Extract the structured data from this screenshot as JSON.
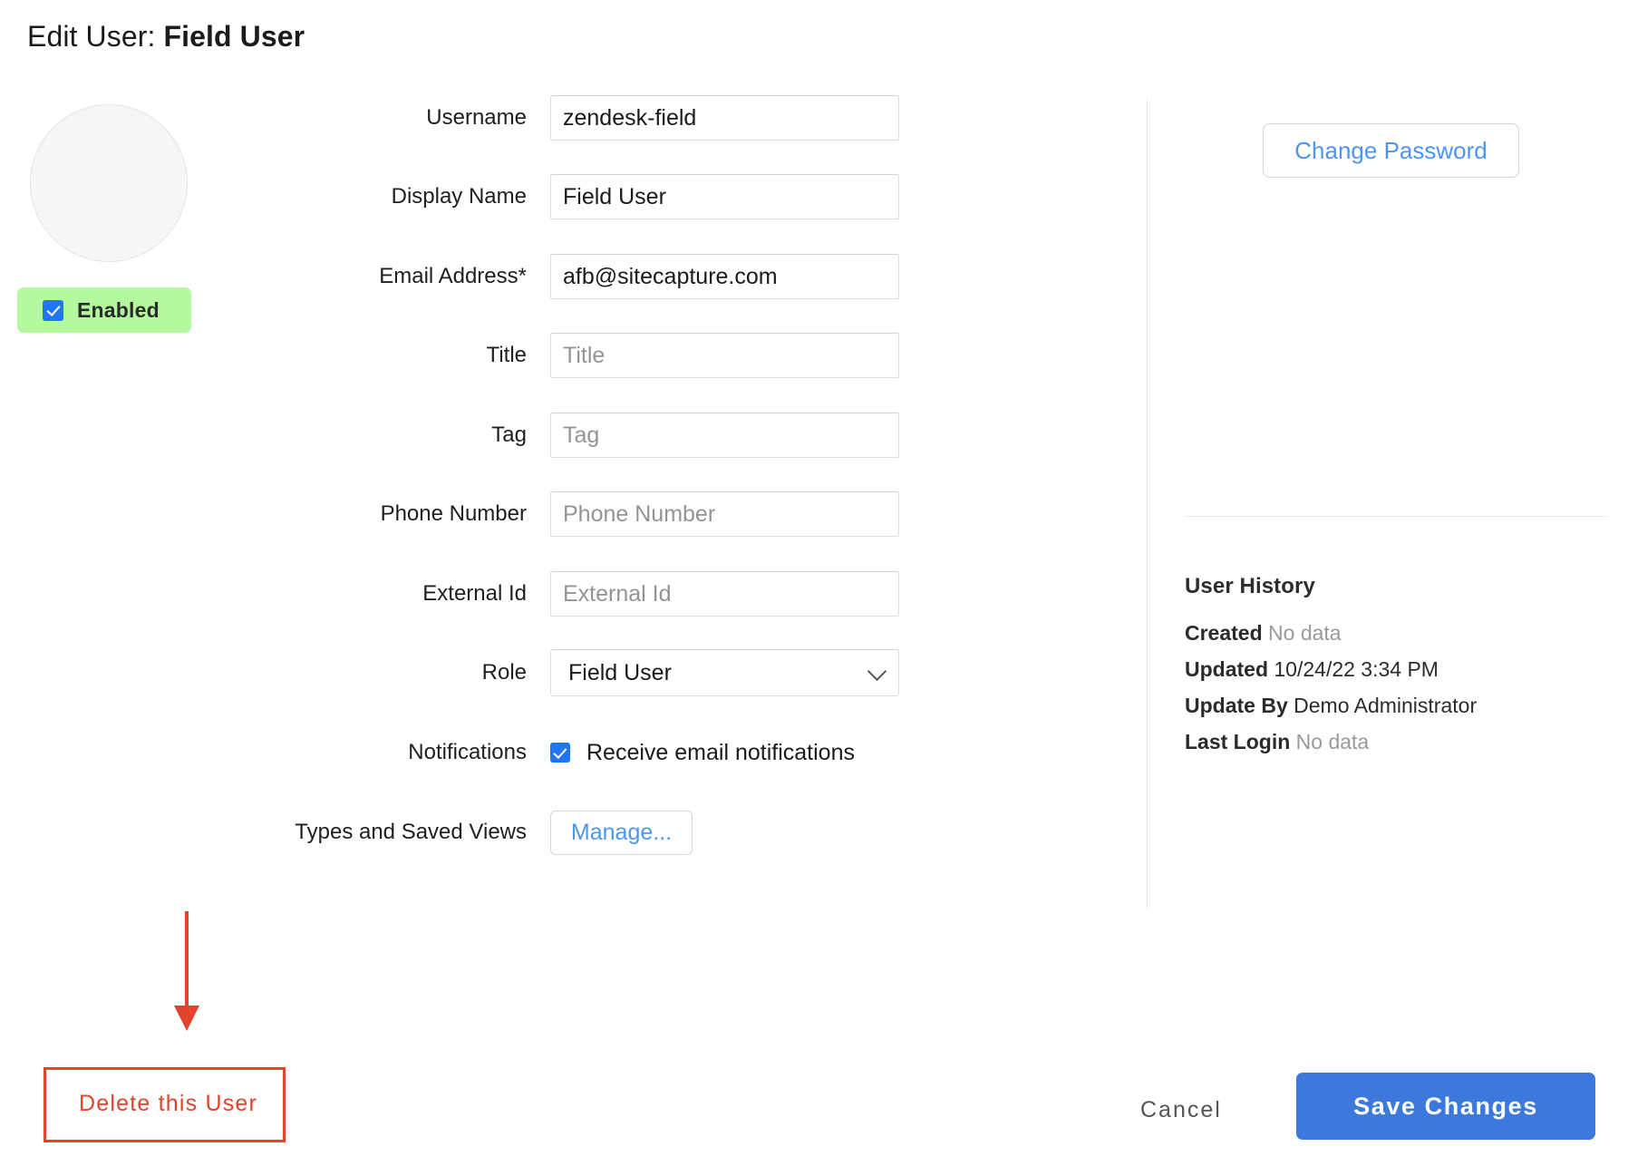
{
  "header": {
    "title_prefix": "Edit User: ",
    "title_name": "Field User"
  },
  "profile": {
    "avatar_alt": "user-avatar",
    "enabled_label": "Enabled",
    "enabled_checked": true
  },
  "form": {
    "fields": [
      {
        "label": "Username",
        "value": "zendesk-field",
        "placeholder": "Username",
        "is_placeholder": false
      },
      {
        "label": "Display Name",
        "value": "Field User",
        "placeholder": "Display Name",
        "is_placeholder": false
      },
      {
        "label": "Email Address*",
        "value": "afb@sitecapture.com",
        "placeholder": "Email Address",
        "is_placeholder": false
      },
      {
        "label": "Title",
        "value": "Title",
        "placeholder": "Title",
        "is_placeholder": true
      },
      {
        "label": "Tag",
        "value": "Tag",
        "placeholder": "Tag",
        "is_placeholder": true
      },
      {
        "label": "Phone Number",
        "value": "Phone Number",
        "placeholder": "Phone Number",
        "is_placeholder": true
      },
      {
        "label": "External Id",
        "value": "External Id",
        "placeholder": "External Id",
        "is_placeholder": true
      }
    ],
    "role": {
      "label": "Role",
      "selected": "Field User"
    },
    "notifications": {
      "label": "Notifications",
      "checkbox_label": "Receive email notifications",
      "checked": true
    },
    "types_and_views": {
      "label": "Types and Saved Views",
      "button_label": "Manage..."
    }
  },
  "side_panel": {
    "change_password_label": "Change Password",
    "history": {
      "title": "User History",
      "rows": [
        {
          "key": "Created",
          "value": "No data",
          "no_data": true
        },
        {
          "key": "Updated",
          "value": "10/24/22 3:34 PM",
          "no_data": false
        },
        {
          "key": "Update By",
          "value": "Demo Administrator",
          "no_data": false
        },
        {
          "key": "Last Login",
          "value": "No data",
          "no_data": true
        }
      ]
    }
  },
  "footer": {
    "delete_label": "Delete this User",
    "cancel_label": "Cancel",
    "save_label": "Save Changes"
  },
  "colors": {
    "accent_blue": "#3c79dd",
    "link_blue": "#4d95f5",
    "checkbox_blue": "#2075f4",
    "enabled_green": "#b4f9a0",
    "danger_red": "#e3432c",
    "annotation_red": "#e3432c",
    "border_gray": "#dedede"
  }
}
